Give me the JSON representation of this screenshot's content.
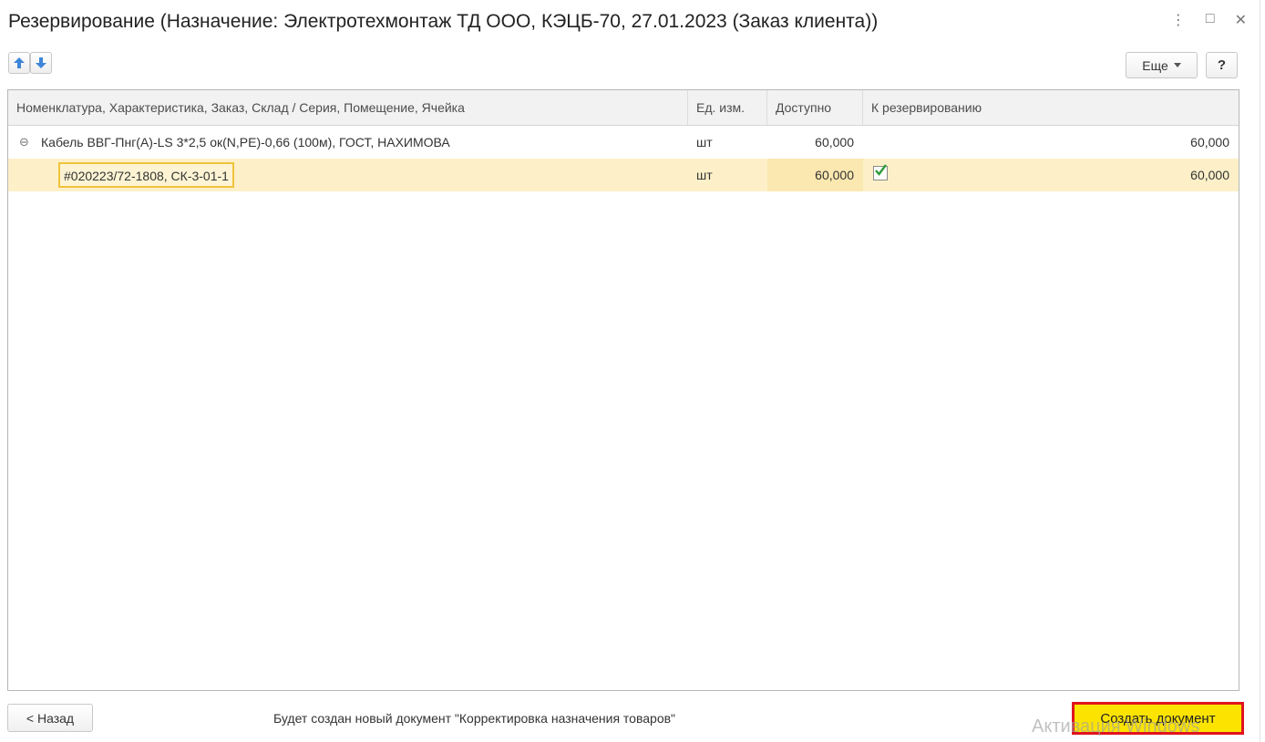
{
  "window": {
    "title": "Резервирование (Назначение: Электротехмонтаж ТД ООО, КЭЦБ-70, 27.01.2023 (Заказ клиента))",
    "controls": {
      "menu": "⋮",
      "maximize": "□",
      "close": "✕"
    }
  },
  "toolbar": {
    "up_icon": "arrow-up-icon",
    "down_icon": "arrow-down-icon",
    "more_label": "Еще",
    "help_label": "?"
  },
  "table": {
    "columns": [
      "Номенклатура, Характеристика, Заказ, Склад / Серия, Помещение, Ячейка",
      "Ед. изм.",
      "Доступно",
      "К резервированию"
    ],
    "rows": [
      {
        "name": "Кабель ВВГ-Пнг(А)-LS 3*2,5 ок(N,PE)-0,66 (100м), ГОСТ, НАХИМОВА",
        "unit": "шт",
        "available": "60,000",
        "reserve": "60,000",
        "expanded": true
      },
      {
        "name": "#020223/72-1808, СК-3-01-1",
        "unit": "шт",
        "available": "60,000",
        "reserve": "60,000",
        "checked": true,
        "selected": true
      }
    ]
  },
  "footer": {
    "back_label": "< Назад",
    "info": "Будет создан новый документ \"Корректировка назначения товаров\"",
    "create_label": "Создать документ",
    "watermark": "Активация Windows"
  },
  "colors": {
    "highlight": "#fce400",
    "selection": "#fdf0c8",
    "alert_border": "#e0141e",
    "check": "#2e9a3a"
  }
}
